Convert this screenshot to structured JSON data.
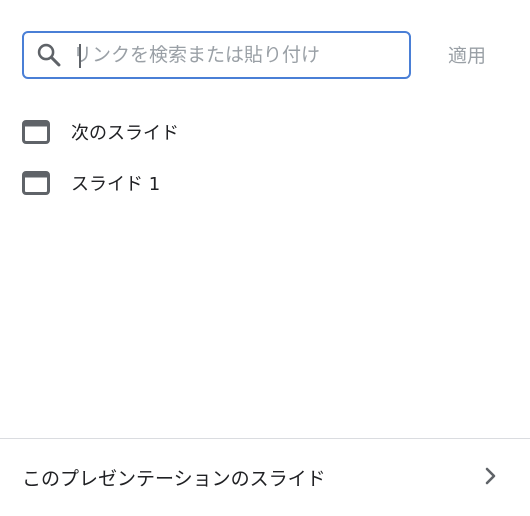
{
  "search": {
    "placeholder": "リンクを検索または貼り付け",
    "value": "",
    "apply_label": "適用"
  },
  "slides": {
    "items": [
      {
        "label": "次のスライド",
        "icon": "slide-icon"
      },
      {
        "label": "スライド 1",
        "icon": "slide-icon"
      }
    ]
  },
  "footer": {
    "label": "このプレゼンテーションのスライド",
    "icon": "chevron-right-icon"
  },
  "colors": {
    "focus_border": "#4a7fd6",
    "disabled_text": "#9aa0a6",
    "icon_gray": "#5f6368",
    "divider": "#dadce0"
  }
}
